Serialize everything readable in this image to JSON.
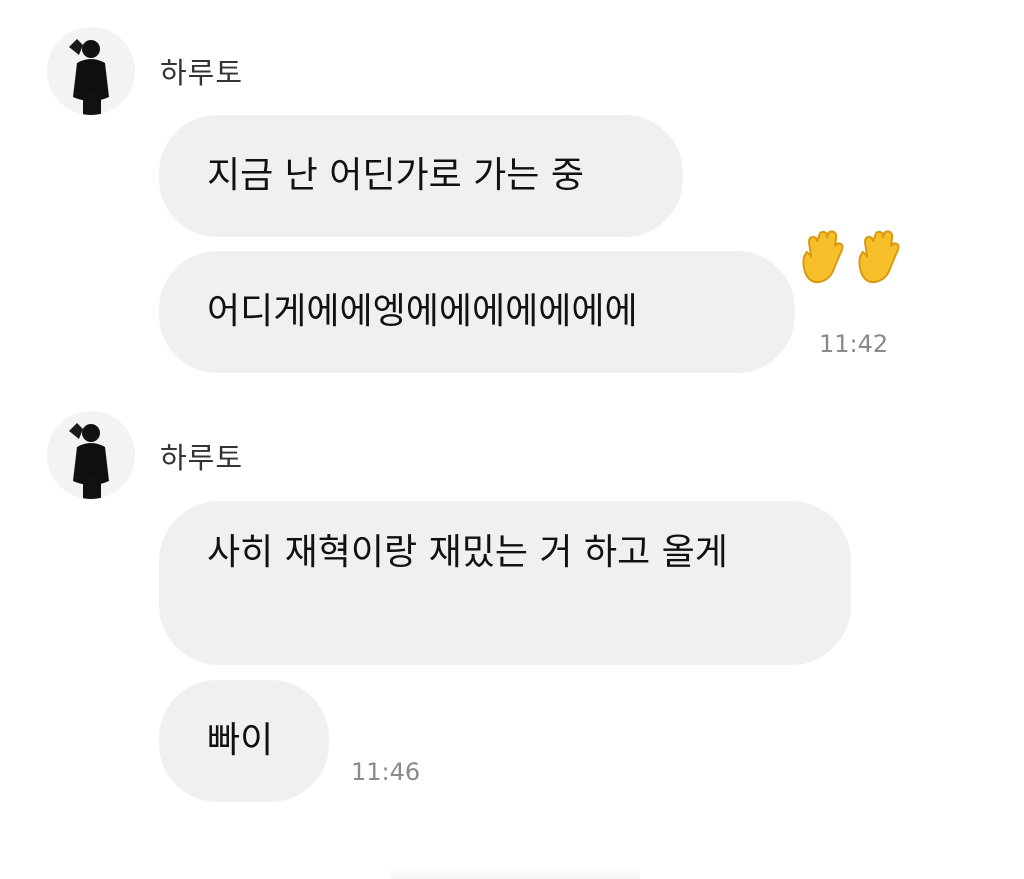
{
  "messages": [
    {
      "sender": "하루토",
      "avatar_icon": "profile-photo-icon",
      "bubbles": [
        "지금 난 어딘가로 가는 중",
        "어디게에에엥에에에에에에에"
      ],
      "reaction_icon": "waving-hands-emoji",
      "time": "11:42"
    },
    {
      "sender": "하루토",
      "avatar_icon": "profile-photo-icon",
      "bubbles": [
        "사히 재혁이랑 재밌는 거 하고 올게",
        "빠이"
      ],
      "time": "11:46"
    }
  ],
  "colors": {
    "bubble": "#f0f0f0",
    "time": "#8a8a8a",
    "reaction": "#f7c02b"
  }
}
